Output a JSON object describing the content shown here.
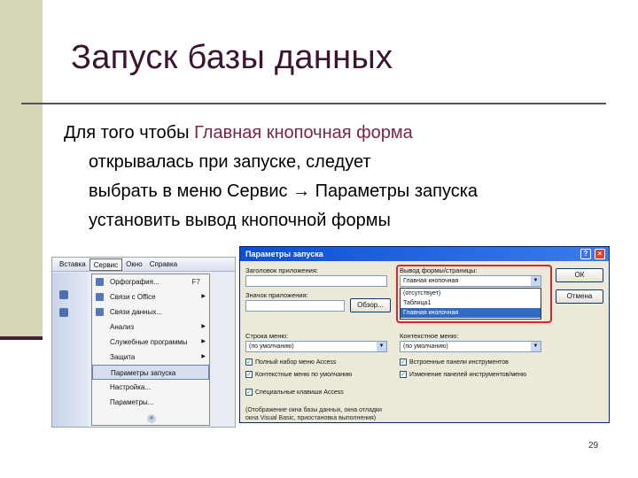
{
  "slide": {
    "title": "Запуск базы данных",
    "body": {
      "line1_pre": "Для того чтобы ",
      "line1_accent": "Главная кнопочная форма",
      "line2": "открывалась при запуске, следует",
      "line3": "выбрать в меню Сервис → Параметры запуска",
      "line4": "установить вывод кнопочной формы"
    },
    "page_number": "29"
  },
  "menu_screenshot": {
    "menubar": [
      "Вставка",
      "Сервис",
      "Окно",
      "Справка"
    ],
    "items": [
      {
        "label": "Орфография...",
        "shortcut": "F7",
        "submenu": false
      },
      {
        "label": "Связи с Office",
        "shortcut": "",
        "submenu": true
      },
      {
        "label": "Связи данных...",
        "shortcut": "",
        "submenu": false
      },
      {
        "label": "Анализ",
        "shortcut": "",
        "submenu": true
      },
      {
        "label": "Служебные программы",
        "shortcut": "",
        "submenu": true
      },
      {
        "label": "Защита",
        "shortcut": "",
        "submenu": true
      },
      {
        "label": "Параметры запуска",
        "shortcut": "",
        "submenu": false
      },
      {
        "label": "Настройка...",
        "shortcut": "",
        "submenu": false
      },
      {
        "label": "Параметры...",
        "shortcut": "",
        "submenu": false
      }
    ],
    "more_glyph": "»"
  },
  "dialog": {
    "title": "Параметры запуска",
    "help_glyph": "?",
    "close_glyph": "×",
    "app_title_label": "Заголовок приложения:",
    "app_icon_label": "Значок приложения:",
    "browse_label": "Обзор...",
    "form_label": "Вывод формы/страницы:",
    "form_value": "Главная кнопочная",
    "form_options": [
      "(отсутствует)",
      "Таблица1",
      "Главная кнопочная"
    ],
    "form_selected_index": 2,
    "menu_bar_label": "Строка меню:",
    "menu_bar_value": "(по умолчанию)",
    "context_menu_label": "Контекстное меню:",
    "context_menu_value": "(по умолчанию)",
    "ok_label": "ОК",
    "cancel_label": "Отмена",
    "checks_left": [
      {
        "label": "Полный набор меню Access",
        "checked": true
      },
      {
        "label": "Контекстные меню по умолчанию",
        "checked": true
      },
      {
        "label": "Специальные клавиши Access",
        "checked": true
      }
    ],
    "checks_right": [
      {
        "label": "Встроенные панели инструментов",
        "checked": true
      },
      {
        "label": "Изменение панелей инструментов/меню",
        "checked": true
      }
    ],
    "note_line1": "(Отображение окна базы данных, окна отладки",
    "note_line2": "окна Visual Basic, приостановка выполнения)"
  }
}
